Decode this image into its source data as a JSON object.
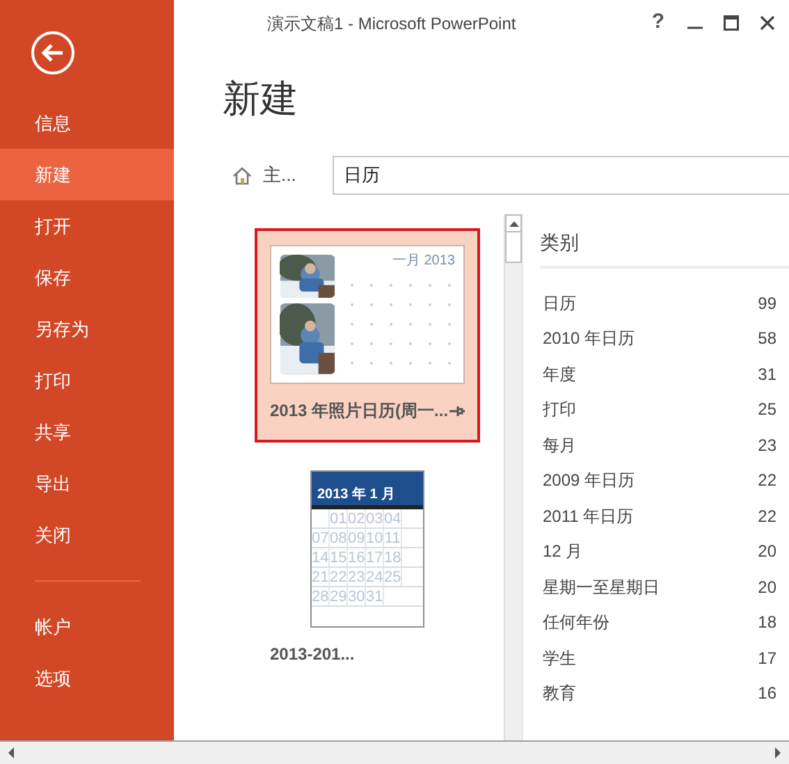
{
  "window": {
    "title": "演示文稿1 - Microsoft PowerPoint",
    "controls": [
      {
        "kind": "help",
        "label": "?"
      },
      {
        "kind": "minimize"
      },
      {
        "kind": "maximize"
      },
      {
        "kind": "close"
      }
    ]
  },
  "sidebar": {
    "items": [
      {
        "label": "信息",
        "selected": false
      },
      {
        "label": "新建",
        "selected": true
      },
      {
        "label": "打开",
        "selected": false
      },
      {
        "label": "保存",
        "selected": false
      },
      {
        "label": "另存为",
        "selected": false
      },
      {
        "label": "打印",
        "selected": false
      },
      {
        "label": "共享",
        "selected": false
      },
      {
        "label": "导出",
        "selected": false
      },
      {
        "label": "关闭",
        "selected": false
      }
    ],
    "footer_items": [
      {
        "label": "帐户",
        "selected": false
      },
      {
        "label": "选项",
        "selected": false
      }
    ]
  },
  "heading": "新建",
  "search": {
    "home_label": "主...",
    "value": "日历"
  },
  "templates": [
    {
      "kind": "photo-calendar",
      "name": "2013 年照片日历(周一...",
      "selected": true,
      "pinned": true,
      "calendar_title": "一月 2013"
    },
    {
      "kind": "grid-calendar",
      "name": "2013-201...",
      "selected": false,
      "pinned": false,
      "calendar_title": "2013 年 1 月",
      "weeks": [
        {
          "lead_blank": true,
          "days": [
            "01",
            "02",
            "03",
            "04"
          ]
        },
        {
          "lead_blank": false,
          "days": [
            "07",
            "08",
            "09",
            "10",
            "11"
          ]
        },
        {
          "lead_blank": false,
          "days": [
            "14",
            "15",
            "16",
            "17",
            "18"
          ]
        },
        {
          "lead_blank": false,
          "days": [
            "21",
            "22",
            "23",
            "24",
            "25"
          ]
        },
        {
          "lead_blank": false,
          "days": [
            "28",
            "29",
            "30",
            "31"
          ]
        }
      ]
    }
  ],
  "categories": {
    "title": "类别",
    "items": [
      {
        "label": "日历",
        "count": "99"
      },
      {
        "label": "2010 年日历",
        "count": "58"
      },
      {
        "label": "年度",
        "count": "31"
      },
      {
        "label": "打印",
        "count": "25"
      },
      {
        "label": "每月",
        "count": "23"
      },
      {
        "label": "2009 年日历",
        "count": "22"
      },
      {
        "label": "2011 年日历",
        "count": "22"
      },
      {
        "label": "12 月",
        "count": "20"
      },
      {
        "label": "星期一至星期日",
        "count": "20"
      },
      {
        "label": "任何年份",
        "count": "18"
      },
      {
        "label": "学生",
        "count": "17"
      },
      {
        "label": "教育",
        "count": "16"
      }
    ]
  }
}
